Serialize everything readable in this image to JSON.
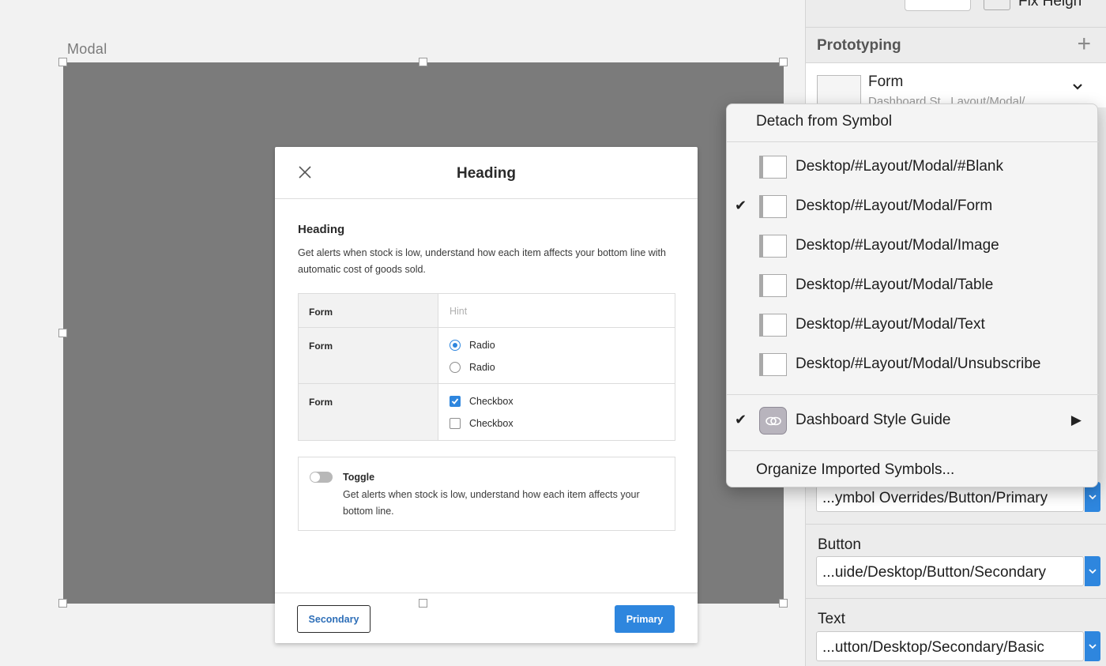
{
  "canvas": {
    "artboard_label": "Modal"
  },
  "modal": {
    "title": "Heading",
    "section_heading": "Heading",
    "section_desc": "Get alerts when stock is low, understand how each item affects your bottom line with automatic cost of goods sold.",
    "rows": [
      {
        "label": "Form",
        "hint": "Hint"
      },
      {
        "label": "Form",
        "options": [
          "Radio",
          "Radio"
        ],
        "selected": 0
      },
      {
        "label": "Form",
        "options": [
          "Checkbox",
          "Checkbox"
        ],
        "checked": [
          true,
          false
        ]
      }
    ],
    "toggle": {
      "title": "Toggle",
      "desc": "Get alerts when stock is low, understand how each item affects your bottom line."
    },
    "secondary_label": "Secondary",
    "primary_label": "Primary"
  },
  "inspector": {
    "fix_text": "Fix Heigh",
    "prototyping_title": "Prototyping",
    "symbol_name": "Form",
    "symbol_path": "Dashboard St...Layout/Modal/...",
    "overrides": [
      {
        "value": "...ymbol Overrides/Button/Primary"
      },
      {
        "label": "Button",
        "value": "...uide/Desktop/Button/Secondary"
      },
      {
        "label": "Text",
        "value": "...utton/Desktop/Secondary/Basic"
      }
    ]
  },
  "menu": {
    "detach": "Detach from Symbol",
    "symbols": [
      {
        "label": "Desktop/#Layout/Modal/#Blank",
        "checked": false
      },
      {
        "label": "Desktop/#Layout/Modal/Form",
        "checked": true
      },
      {
        "label": "Desktop/#Layout/Modal/Image",
        "checked": false
      },
      {
        "label": "Desktop/#Layout/Modal/Table",
        "checked": false
      },
      {
        "label": "Desktop/#Layout/Modal/Text",
        "checked": false
      },
      {
        "label": "Desktop/#Layout/Modal/Unsubscribe",
        "checked": false
      }
    ],
    "library": "Dashboard Style Guide",
    "organize": "Organize Imported Symbols..."
  },
  "colors": {
    "accent": "#2e86de",
    "artboard": "#7b7b7b"
  }
}
